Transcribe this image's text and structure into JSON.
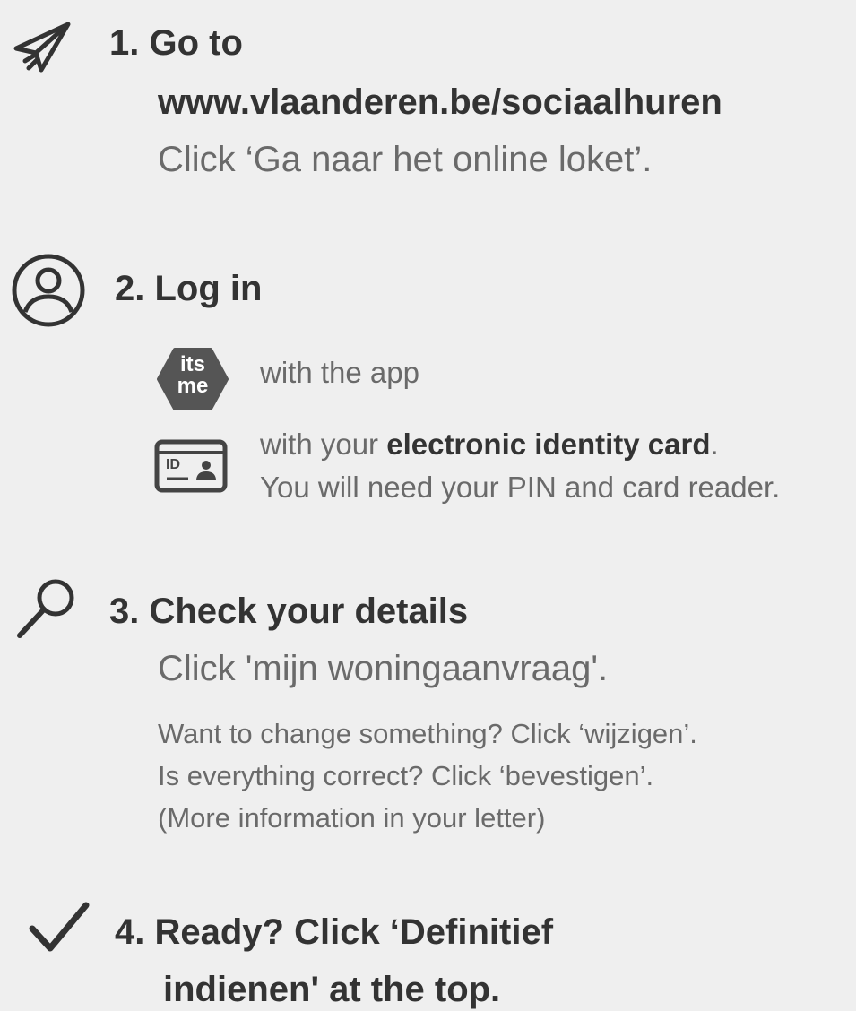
{
  "step1": {
    "title": "1. Go to",
    "url": "www.vlaanderen.be/sociaalhuren",
    "instruction": "Click ‘Ga naar het online loket’."
  },
  "step2": {
    "title": "2. Log in",
    "itsme_logo_top": "its",
    "itsme_logo_bottom": "me",
    "app_text": "with the app",
    "eid_prefix": "with your ",
    "eid_bold": "electronic identity card",
    "eid_suffix": ".",
    "eid_note": "You will need your PIN and card reader.",
    "card_label": "ID"
  },
  "step3": {
    "title": "3. Check your details",
    "instruction": "Click 'mijn woningaanvraag'.",
    "note1": "Want to change something? Click ‘wijzigen’.",
    "note2": "Is everything correct? Click ‘bevestigen’.",
    "note3": "(More information in your letter)"
  },
  "step4": {
    "title_line1": "4. Ready? Click ‘Definitief",
    "title_line2": "indienen' at the top."
  },
  "icons": [
    "paper-plane-icon",
    "user-circle-icon",
    "itsme-logo",
    "id-card-icon",
    "magnifier-icon",
    "checkmark-icon"
  ]
}
